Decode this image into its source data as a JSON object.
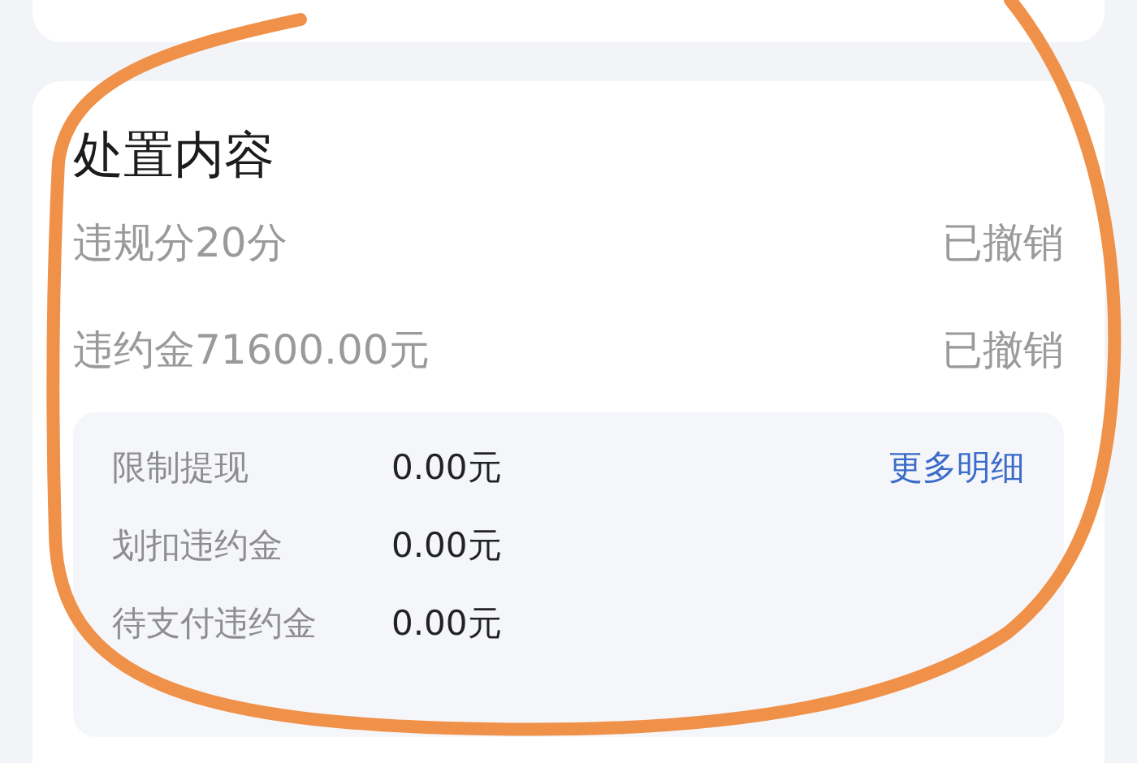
{
  "section": {
    "title": "处置内容",
    "items": [
      {
        "label": "违规分20分",
        "status": "已撤销"
      },
      {
        "label": "违约金71600.00元",
        "status": "已撤销"
      }
    ],
    "details": {
      "link": "更多明细",
      "rows": [
        {
          "label": "限制提现",
          "value": "0.00元"
        },
        {
          "label": "划扣违约金",
          "value": "0.00元"
        },
        {
          "label": "待支付违约金",
          "value": "0.00元"
        }
      ]
    }
  },
  "annotation": {
    "kind": "circle"
  }
}
